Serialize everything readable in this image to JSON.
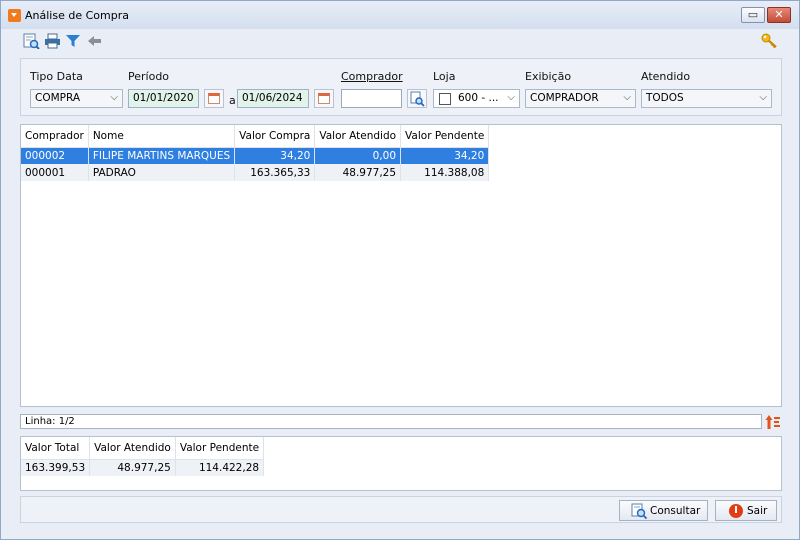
{
  "window": {
    "title": "Análise de Compra"
  },
  "filters": {
    "tipo_data": {
      "label": "Tipo Data",
      "value": "COMPRA"
    },
    "periodo": {
      "label": "Período",
      "start": "01/01/2020",
      "separator": "a",
      "end": "01/06/2024"
    },
    "comprador": {
      "label": "Comprador",
      "value": ""
    },
    "loja": {
      "label": "Loja",
      "value": "600 - ..."
    },
    "exibicao": {
      "label": "Exibição",
      "value": "COMPRADOR"
    },
    "atendido": {
      "label": "Atendido",
      "value": "TODOS"
    }
  },
  "grid": {
    "columns": [
      "Comprador",
      "Nome",
      "Valor Compra",
      "Valor Atendido",
      "Valor Pendente"
    ],
    "rows": [
      {
        "comprador": "000002",
        "nome": "FILIPE MARTINS MARQUES",
        "valor_compra": "34,20",
        "valor_atendido": "0,00",
        "valor_pendente": "34,20"
      },
      {
        "comprador": "000001",
        "nome": "PADRAO",
        "valor_compra": "163.365,33",
        "valor_atendido": "48.977,25",
        "valor_pendente": "114.388,08"
      }
    ]
  },
  "status": {
    "linha": "Linha: 1/2"
  },
  "totals": {
    "columns": [
      "Valor Total",
      "Valor Atendido",
      "Valor Pendente"
    ],
    "values": [
      "163.399,53",
      "48.977,25",
      "114.422,28"
    ]
  },
  "buttons": {
    "consultar": "Consultar",
    "sair": "Sair"
  },
  "colors": {
    "selection": "#2f7fe0",
    "accent_orange": "#f07a1c",
    "filter_blue": "#2a7fd4",
    "exit_red": "#e23c17"
  },
  "icons": [
    "preview-icon",
    "print-icon",
    "filter-icon",
    "back-arrow-icon",
    "key-icon",
    "calendar-icon",
    "search-icon",
    "sort-icon",
    "exit-icon"
  ]
}
